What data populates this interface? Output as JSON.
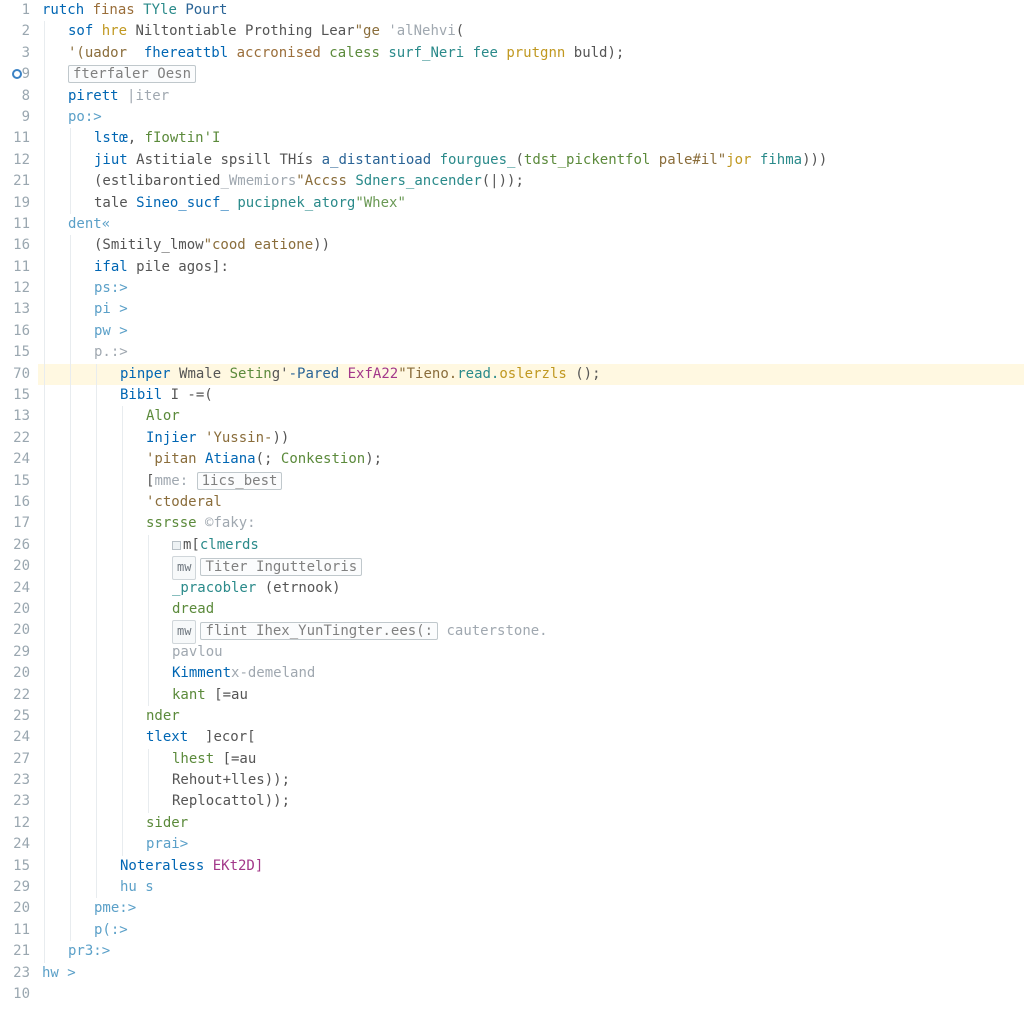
{
  "gutter_icons": {
    "3": "blue-circle",
    "16": "warn",
    "41": "dots"
  },
  "highlighted_lines": [
    16
  ],
  "lines": [
    {
      "num": "1",
      "indent": 0,
      "segments": [
        {
          "t": "rutch ",
          "c": "kw"
        },
        {
          "t": "finas ",
          "c": "brown"
        },
        {
          "t": "TYle ",
          "c": "teal"
        },
        {
          "t": "Pourt",
          "c": "kw2"
        }
      ]
    },
    {
      "num": "2",
      "indent": 1,
      "segments": [
        {
          "t": "sof ",
          "c": "kw"
        },
        {
          "t": "hre ",
          "c": "warn"
        },
        {
          "t": "Niltontiable Prothing Lear",
          "c": "op"
        },
        {
          "t": "\"ge ",
          "c": "str"
        },
        {
          "t": "'alNehvi",
          "c": "pale"
        },
        {
          "t": "(",
          "c": "op"
        }
      ]
    },
    {
      "num": "3",
      "indent": 1,
      "segments": [
        {
          "t": "'(uador  ",
          "c": "str"
        },
        {
          "t": "fhereattbl ",
          "c": "kw"
        },
        {
          "t": "accronised ",
          "c": "brown"
        },
        {
          "t": "caless ",
          "c": "fn"
        },
        {
          "t": "surf_Neri fee ",
          "c": "teal"
        },
        {
          "t": "prutgnn ",
          "c": "warn"
        },
        {
          "t": "buld);",
          "c": "op"
        }
      ]
    },
    {
      "num": "9",
      "indent": 1,
      "has_blue_icon": true,
      "segments": [
        {
          "t": "",
          "c": "op"
        },
        {
          "box": true,
          "t": "fterfaler Oesn",
          "c": "gray"
        }
      ]
    },
    {
      "num": "8",
      "indent": 1,
      "segments": [
        {
          "t": "pirett ",
          "c": "kw"
        },
        {
          "t": "|iter",
          "c": "pale"
        }
      ]
    },
    {
      "num": "9",
      "indent": 1,
      "segments": [
        {
          "t": "po:>",
          "c": "lightblue"
        }
      ]
    },
    {
      "num": "11",
      "indent": 2,
      "segments": [
        {
          "t": "lstœ",
          "c": "kw"
        },
        {
          "t": ", ",
          "c": "op"
        },
        {
          "t": "fIowtin'I",
          "c": "fn"
        }
      ]
    },
    {
      "num": "12",
      "indent": 2,
      "segments": [
        {
          "t": "jiut ",
          "c": "kw"
        },
        {
          "t": "Astitiale spsill THís ",
          "c": "op"
        },
        {
          "t": "a_distantioad ",
          "c": "kw2"
        },
        {
          "t": "fourgues_",
          "c": "teal"
        },
        {
          "t": "(",
          "c": "op"
        },
        {
          "t": "tdst_pickentfol ",
          "c": "fn"
        },
        {
          "t": "pale#il\"",
          "c": "str"
        },
        {
          "t": "jor ",
          "c": "warn"
        },
        {
          "t": "fihma",
          "c": "teal"
        },
        {
          "t": ")))",
          "c": "op"
        }
      ]
    },
    {
      "num": "21",
      "indent": 2,
      "segments": [
        {
          "t": "(estlibarontied",
          "c": "op"
        },
        {
          "t": "_Wmemiors",
          "c": "pale"
        },
        {
          "t": "\"Accss ",
          "c": "str"
        },
        {
          "t": "Sdners_ancender",
          "c": "teal"
        },
        {
          "t": "(|));",
          "c": "op"
        }
      ]
    },
    {
      "num": "19",
      "indent": 2,
      "segments": [
        {
          "t": "tale ",
          "c": "op"
        },
        {
          "t": "Sineo_sucf_ ",
          "c": "kw"
        },
        {
          "t": "pucipnek_atorg",
          "c": "teal"
        },
        {
          "t": "\"Whex\"",
          "c": "str2"
        }
      ]
    },
    {
      "num": "11",
      "indent": 1,
      "segments": [
        {
          "t": "dent«",
          "c": "lightblue"
        }
      ]
    },
    {
      "num": "16",
      "indent": 2,
      "segments": [
        {
          "t": "(Smitily_lmow",
          "c": "op"
        },
        {
          "t": "\"cood eatione",
          "c": "str"
        },
        {
          "t": "))",
          "c": "op"
        }
      ]
    },
    {
      "num": "11",
      "indent": 2,
      "segments": [
        {
          "t": "ifal ",
          "c": "kw"
        },
        {
          "t": "pile agos]:",
          "c": "op"
        }
      ]
    },
    {
      "num": "12",
      "indent": 2,
      "segments": [
        {
          "t": "ps:>",
          "c": "lightblue"
        }
      ]
    },
    {
      "num": "13",
      "indent": 2,
      "segments": [
        {
          "t": "pi >",
          "c": "lightblue"
        }
      ]
    },
    {
      "num": "16",
      "indent": 2,
      "segments": [
        {
          "t": "pw >",
          "c": "lightblue"
        }
      ]
    },
    {
      "num": "15",
      "indent": 2,
      "segments": [
        {
          "t": "p.:>",
          "c": "pale"
        }
      ]
    },
    {
      "num": "70",
      "indent": 3,
      "hl": true,
      "left_marker": "s",
      "segments": [
        {
          "t": "pinper ",
          "c": "kw"
        },
        {
          "t": "Wmale ",
          "c": "op"
        },
        {
          "t": "Setin",
          "c": "fn"
        },
        {
          "t": "g'",
          "c": "op"
        },
        {
          "t": "-Pared ",
          "c": "kw2"
        },
        {
          "t": "ExfA22",
          "c": "mag"
        },
        {
          "t": "\"Tieno.",
          "c": "str"
        },
        {
          "t": "read.",
          "c": "teal"
        },
        {
          "t": "oslerzls ",
          "c": "warn"
        },
        {
          "t": "();",
          "c": "op"
        }
      ]
    },
    {
      "num": "15",
      "indent": 3,
      "segments": [
        {
          "t": "Bibil ",
          "c": "kw"
        },
        {
          "t": "I -=(",
          "c": "op"
        }
      ]
    },
    {
      "num": "13",
      "indent": 4,
      "segments": [
        {
          "t": "Alor",
          "c": "fn"
        }
      ]
    },
    {
      "num": "22",
      "indent": 4,
      "segments": [
        {
          "t": "Injier ",
          "c": "kw"
        },
        {
          "t": "'Yussin-",
          "c": "str"
        },
        {
          "t": "))",
          "c": "op"
        }
      ]
    },
    {
      "num": "24",
      "indent": 4,
      "segments": [
        {
          "t": "'pitan ",
          "c": "str"
        },
        {
          "t": "Atiana",
          "c": "kw"
        },
        {
          "t": "(; ",
          "c": "op"
        },
        {
          "t": "Conkestion",
          "c": "fn"
        },
        {
          "t": ");",
          "c": "op"
        }
      ]
    },
    {
      "num": "15",
      "indent": 4,
      "segments": [
        {
          "t": "[",
          "c": "op"
        },
        {
          "t": "mme: ",
          "c": "pale"
        },
        {
          "box": true,
          "t": "1ics_best",
          "c": "gray"
        }
      ]
    },
    {
      "num": "16",
      "indent": 4,
      "segments": [
        {
          "t": "'ctoderal",
          "c": "str"
        }
      ]
    },
    {
      "num": "17",
      "indent": 4,
      "segments": [
        {
          "t": "ssrsse ",
          "c": "fn"
        },
        {
          "t": "©faky:",
          "c": "pale"
        }
      ]
    },
    {
      "num": "26",
      "indent": 5,
      "fold": true,
      "segments": [
        {
          "t": "m[",
          "c": "op"
        },
        {
          "t": "clmerds",
          "c": "teal"
        }
      ]
    },
    {
      "num": "20",
      "indent": 5,
      "segments": [
        {
          "hint": true,
          "t": "mw"
        },
        {
          "box": true,
          "t": "Titer Ingutteloris",
          "c": "gray"
        }
      ]
    },
    {
      "num": "24",
      "indent": 5,
      "segments": [
        {
          "t": "_pracobler ",
          "c": "teal"
        },
        {
          "t": "(etrnook)",
          "c": "op"
        }
      ]
    },
    {
      "num": "20",
      "indent": 5,
      "left_dots": true,
      "segments": [
        {
          "t": "dread",
          "c": "fn"
        }
      ]
    },
    {
      "num": "20",
      "indent": 5,
      "segments": [
        {
          "hint": true,
          "t": "mw"
        },
        {
          "box": true,
          "t": "flint Ihex_YunTingter.ees(:",
          "c": "gray"
        },
        {
          "t": " cauterstone.",
          "c": "pale"
        }
      ]
    },
    {
      "num": "29",
      "indent": 5,
      "segments": [
        {
          "t": "pavlou",
          "c": "pale"
        }
      ]
    },
    {
      "num": "20",
      "indent": 5,
      "segments": [
        {
          "t": "Kimment",
          "c": "kw"
        },
        {
          "t": "x-demeland",
          "c": "pale"
        }
      ]
    },
    {
      "num": "22",
      "indent": 5,
      "segments": [
        {
          "t": "kant ",
          "c": "fn"
        },
        {
          "t": "[=au",
          "c": "op"
        }
      ]
    },
    {
      "num": "25",
      "indent": 4,
      "segments": [
        {
          "t": "nder",
          "c": "fn"
        }
      ]
    },
    {
      "num": "24",
      "indent": 4,
      "segments": [
        {
          "t": "tlext  ",
          "c": "kw"
        },
        {
          "t": "]ecor[",
          "c": "op"
        }
      ]
    },
    {
      "num": "27",
      "indent": 5,
      "segments": [
        {
          "t": "lhest ",
          "c": "fn"
        },
        {
          "t": "[=au",
          "c": "op"
        }
      ]
    },
    {
      "num": "23",
      "indent": 5,
      "segments": [
        {
          "t": "Rehout+lles",
          "c": "op"
        },
        {
          "t": "));",
          "c": "op"
        }
      ]
    },
    {
      "num": "23",
      "indent": 5,
      "segments": [
        {
          "t": "Replocattol",
          "c": "op"
        },
        {
          "t": "));",
          "c": "op"
        }
      ]
    },
    {
      "num": "12",
      "indent": 4,
      "segments": [
        {
          "t": "sider",
          "c": "fn"
        }
      ]
    },
    {
      "num": "24",
      "indent": 4,
      "segments": [
        {
          "t": "prai>",
          "c": "lightblue"
        }
      ]
    },
    {
      "num": "15",
      "indent": 3,
      "segments": [
        {
          "t": "Noteraless ",
          "c": "kw"
        },
        {
          "t": "EKt2D]",
          "c": "mag"
        }
      ]
    },
    {
      "num": "29",
      "indent": 3,
      "segments": [
        {
          "t": "hu s",
          "c": "lightblue"
        }
      ]
    },
    {
      "num": "20",
      "indent": 2,
      "segments": [
        {
          "t": "pme:>",
          "c": "lightblue"
        }
      ]
    },
    {
      "num": "11",
      "indent": 2,
      "segments": [
        {
          "t": "p(:>",
          "c": "lightblue"
        }
      ]
    },
    {
      "num": "21",
      "indent": 1,
      "segments": [
        {
          "t": "pr3:>",
          "c": "lightblue"
        }
      ]
    },
    {
      "num": "23",
      "indent": 0,
      "segments": [
        {
          "t": "hw >",
          "c": "lightblue"
        }
      ]
    },
    {
      "num": "10",
      "indent": 0,
      "segments": [
        {
          "t": "",
          "c": "op"
        }
      ]
    }
  ]
}
